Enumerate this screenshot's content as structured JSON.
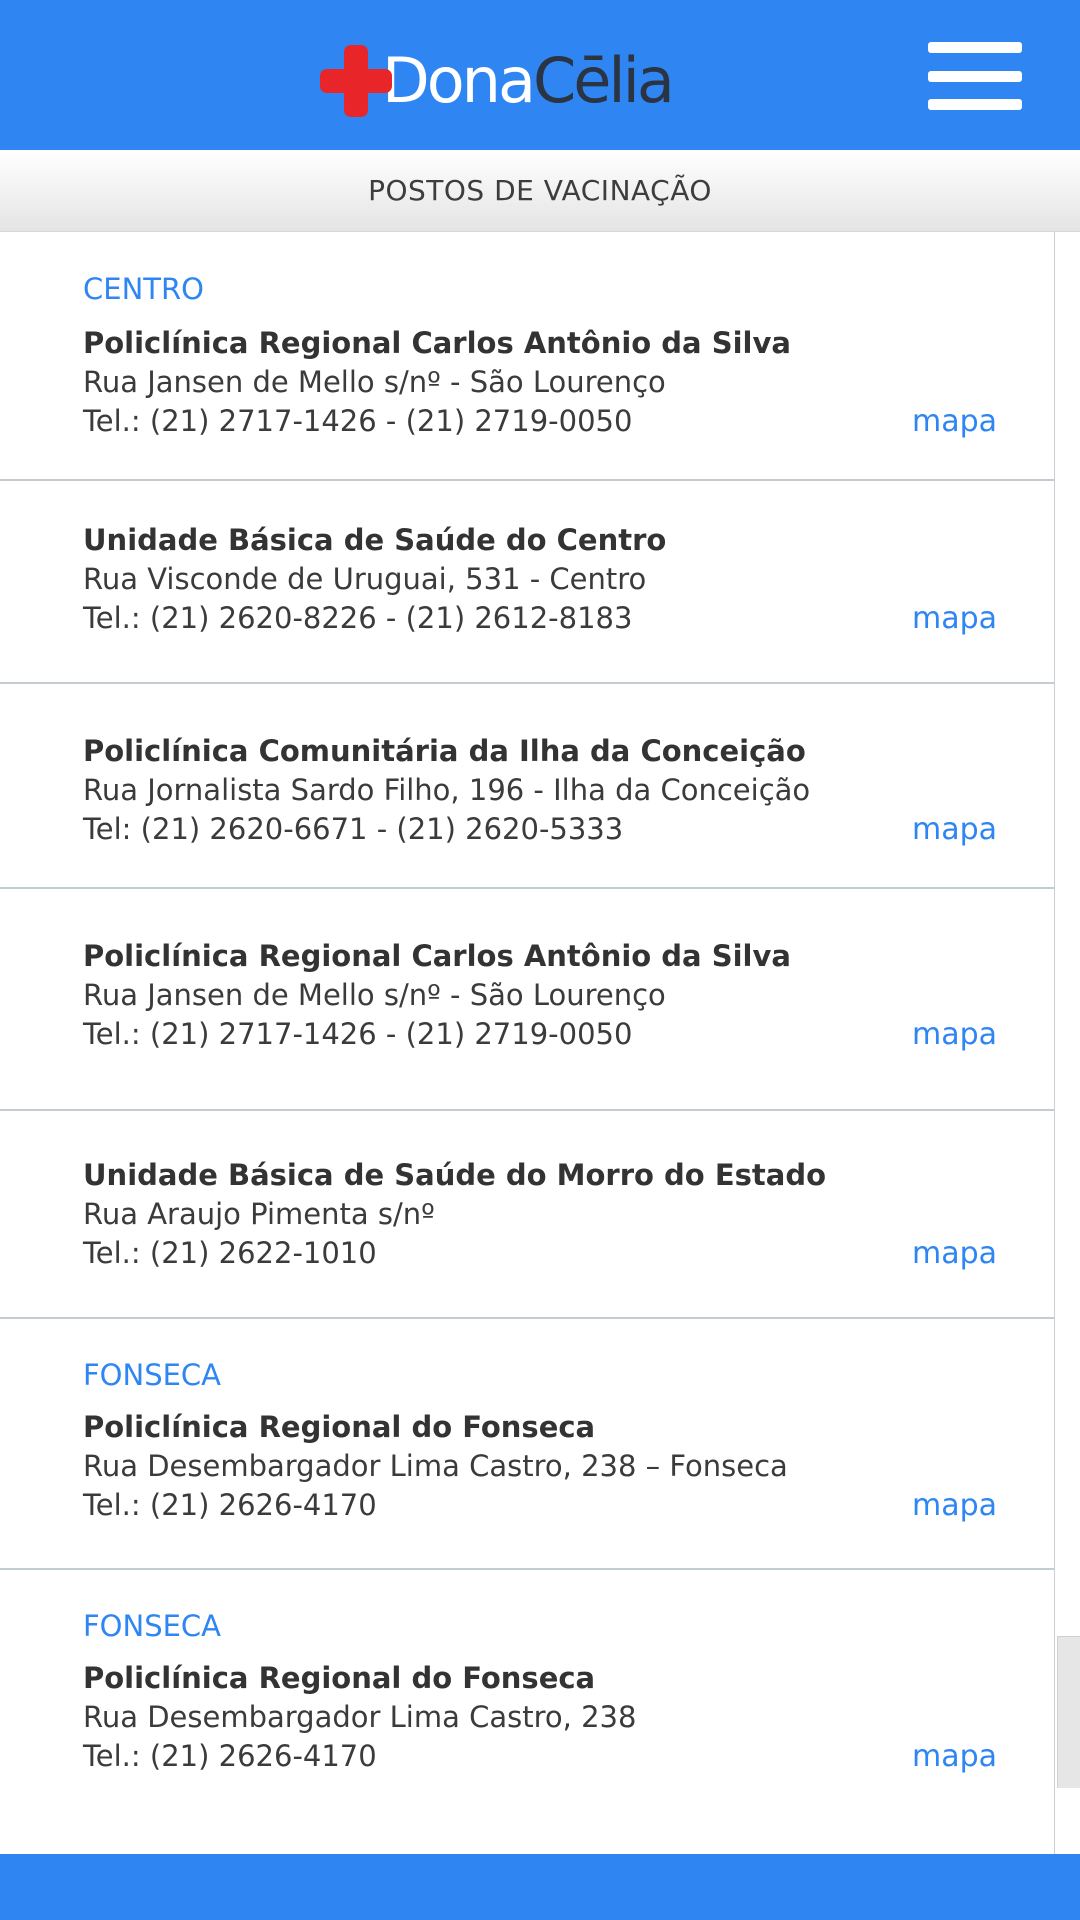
{
  "header": {
    "logo_dona": "Dona",
    "logo_celia": "Cēlia"
  },
  "subheader": {
    "title": "POSTOS DE VACINAÇÃO"
  },
  "list": [
    {
      "region": "CENTRO",
      "name": "Policlínica Regional Carlos Antônio da Silva",
      "address": "Rua Jansen de Mello s/nº - São Lourenço",
      "phone": "Tel.: (21) 2717-1426 - (21) 2719-0050",
      "map": "mapa"
    },
    {
      "region": "",
      "name": "Unidade Básica de Saúde do Centro",
      "address": "Rua Visconde de Uruguai, 531 - Centro",
      "phone": "Tel.: (21) 2620-8226 - (21) 2612-8183",
      "map": "mapa"
    },
    {
      "region": "",
      "name": "Policlínica Comunitária da Ilha da Conceição",
      "address": "Rua Jornalista Sardo Filho, 196 - Ilha da Conceição",
      "phone": "Tel: (21) 2620-6671 - (21) 2620-5333",
      "map": "mapa"
    },
    {
      "region": "",
      "name": "Policlínica Regional Carlos Antônio da Silva",
      "address": "Rua Jansen de Mello s/nº - São Lourenço",
      "phone": "Tel.: (21) 2717-1426 - (21) 2719-0050",
      "map": "mapa"
    },
    {
      "region": "",
      "name": "Unidade Básica de Saúde do Morro do Estado",
      "address": "Rua Araujo Pimenta s/nº",
      "phone": "Tel.: (21) 2622-1010",
      "map": "mapa"
    },
    {
      "region": "FONSECA",
      "name": "Policlínica Regional do Fonseca",
      "address": "Rua Desembargador Lima Castro, 238 – Fonseca",
      "phone": "Tel.: (21) 2626-4170",
      "map": "mapa"
    },
    {
      "region": "FONSECA",
      "name": "Policlínica Regional do Fonseca",
      "address": "Rua Desembargador Lima Castro, 238",
      "phone": "Tel.: (21) 2626-4170",
      "map": "mapa"
    }
  ],
  "colors": {
    "brand_blue": "#2f86f3",
    "logo_cross_red": "#e8262a",
    "logo_dark": "#2b3442"
  },
  "icons": {
    "menu": "hamburger-menu-icon",
    "logo_mark": "red-cross-icon"
  }
}
